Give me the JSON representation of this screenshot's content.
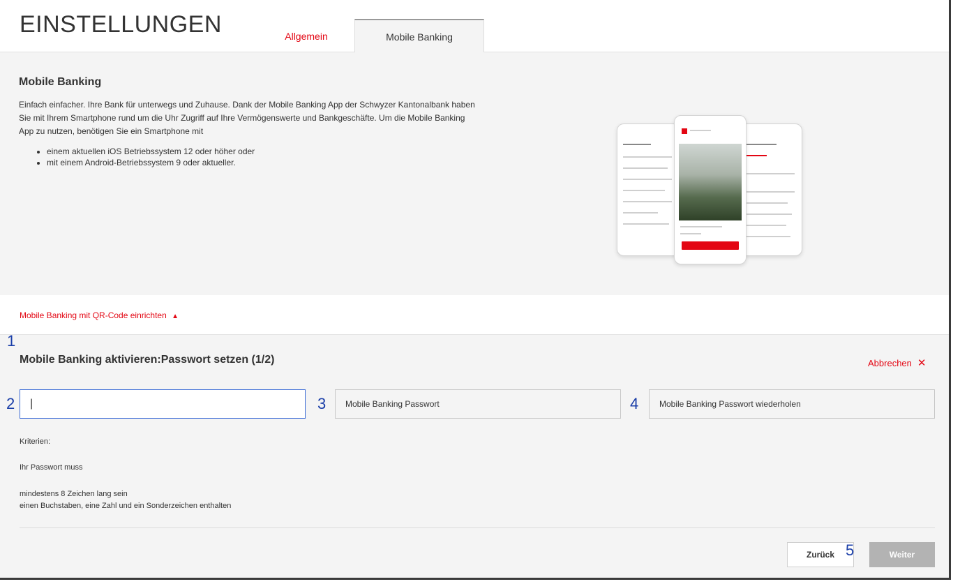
{
  "header": {
    "title": "EINSTELLUNGEN",
    "tabs": [
      {
        "label": "Allgemein",
        "active": false
      },
      {
        "label": "Mobile Banking",
        "active": true
      }
    ]
  },
  "intro": {
    "title": "Mobile Banking",
    "text": "Einfach einfacher. Ihre Bank für unterwegs und Zuhause. Dank der Mobile Banking App der Schwyzer Kantonalbank haben Sie mit Ihrem Smartphone rund um die Uhr Zugriff auf Ihre Vermögenswerte und Bankgeschäfte. Um die Mobile Banking App zu nutzen, benötigen Sie ein Smartphone mit",
    "requirements": [
      "einem aktuellen iOS Betriebssystem 12 oder höher oder",
      "mit einem Android-Betriebssystem 9 oder aktueller."
    ]
  },
  "qr_setup": {
    "link_label": "Mobile Banking mit QR-Code einrichten",
    "link_icon": "chevron-up-icon"
  },
  "activation": {
    "title": "Mobile Banking aktivieren:Passwort setzen (1/2)",
    "cancel_label": "Abbrechen",
    "cancel_icon": "close-icon",
    "fields": [
      {
        "value": "|",
        "placeholder": ""
      },
      {
        "value": "",
        "placeholder": "Mobile Banking Passwort"
      },
      {
        "value": "",
        "placeholder": "Mobile Banking Passwort wiederholen"
      }
    ],
    "criteria_heading": "Kriterien:",
    "criteria_intro": "Ihr Passwort muss",
    "criteria": [
      "mindestens 8 Zeichen lang sein",
      "einen Buchstaben, eine Zahl und ein Sonderzeichen enthalten"
    ],
    "back_label": "Zurück",
    "next_label": "Weiter"
  },
  "markers": [
    "1",
    "2",
    "3",
    "4",
    "5"
  ],
  "colors": {
    "accent": "#e30613",
    "marker": "#1a3ea8",
    "panel": "#f4f4f4",
    "disabled_button": "#b3b3b3"
  }
}
